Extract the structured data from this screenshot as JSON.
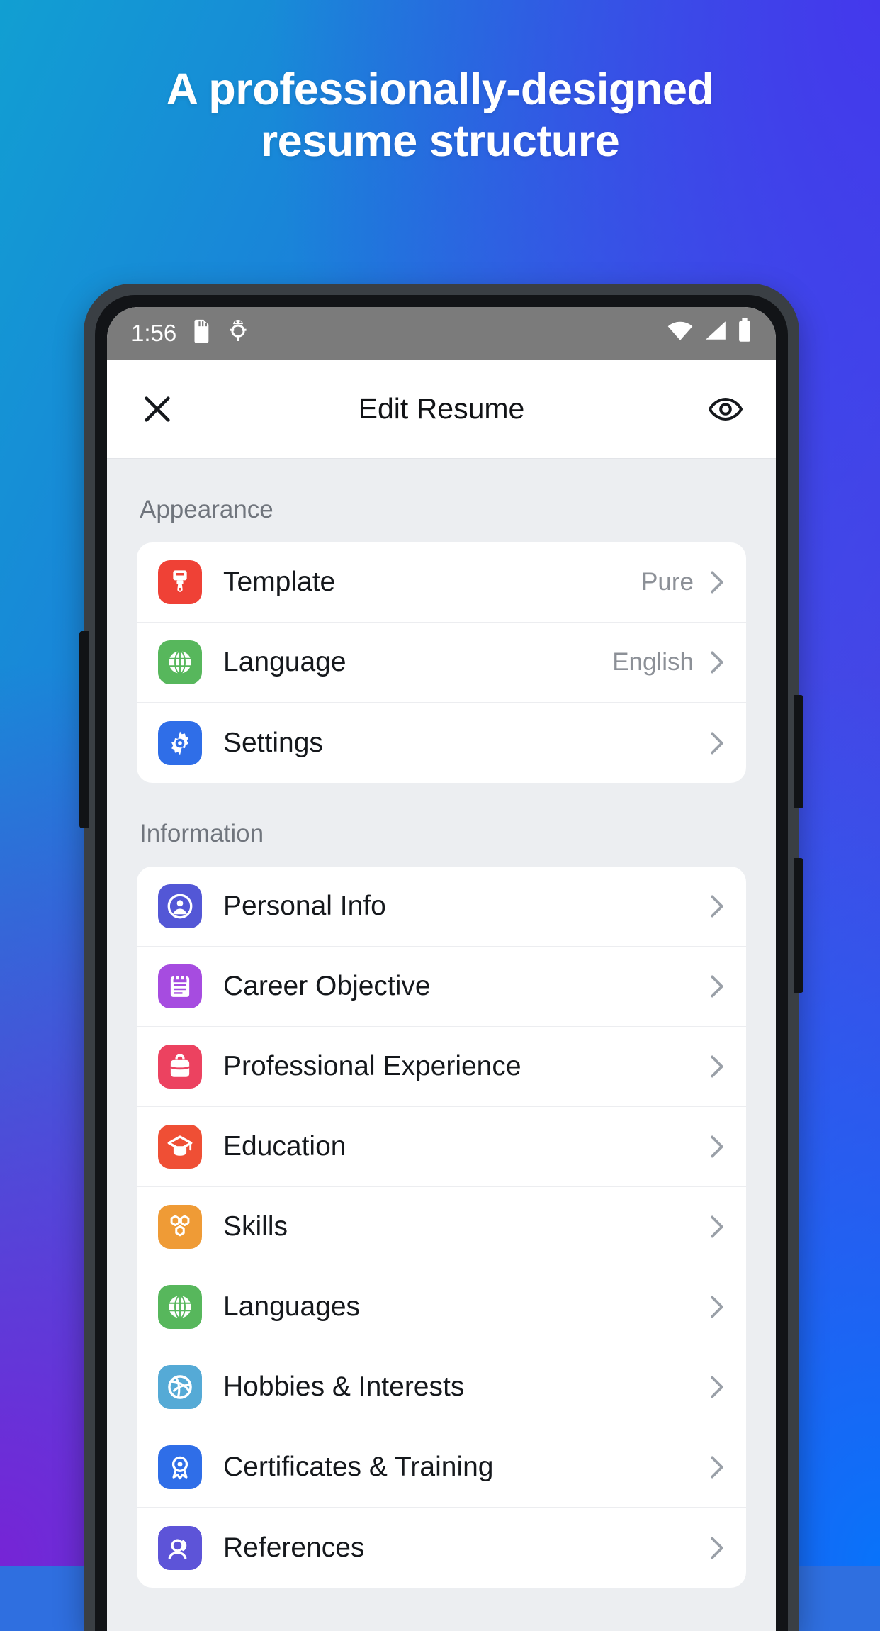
{
  "promo": {
    "headline_line1": "A professionally-designed",
    "headline_line2": "resume structure",
    "gradient": {
      "top_left": "#119fd2",
      "top_right": "#4438ec",
      "bottom_left": "#7624d6",
      "bottom_right": "#0873fa"
    }
  },
  "statusbar": {
    "time": "1:56",
    "left_icons": [
      "sd-card-icon",
      "usb-debug-icon"
    ],
    "right_icons": [
      "wifi-icon",
      "cellular-signal-icon",
      "battery-icon"
    ],
    "background": "#7b7b7b"
  },
  "appbar": {
    "close_label": "close-icon",
    "title": "Edit Resume",
    "preview_label": "eye-icon"
  },
  "sections": [
    {
      "title": "Appearance",
      "rows": [
        {
          "label": "Template",
          "value": "Pure",
          "icon": "brush-icon",
          "icon_color": "#ef4136"
        },
        {
          "label": "Language",
          "value": "English",
          "icon": "globe-icon",
          "icon_color": "#57b75c"
        },
        {
          "label": "Settings",
          "value": "",
          "icon": "gear-icon",
          "icon_color": "#2f6ee8"
        }
      ]
    },
    {
      "title": "Information",
      "rows": [
        {
          "label": "Personal Info",
          "value": "",
          "icon": "person-circle-icon",
          "icon_color": "#5357d6"
        },
        {
          "label": "Career Objective",
          "value": "",
          "icon": "notepad-icon",
          "icon_color": "#a64ce0"
        },
        {
          "label": "Professional Experience",
          "value": "",
          "icon": "briefcase-icon",
          "icon_color": "#ec4260"
        },
        {
          "label": "Education",
          "value": "",
          "icon": "graduation-cap-icon",
          "icon_color": "#ef4f35"
        },
        {
          "label": "Skills",
          "value": "",
          "icon": "honeycomb-icon",
          "icon_color": "#ef9b36"
        },
        {
          "label": "Languages",
          "value": "",
          "icon": "globe-icon",
          "icon_color": "#57b75c"
        },
        {
          "label": "Hobbies & Interests",
          "value": "",
          "icon": "basketball-icon",
          "icon_color": "#55aad6"
        },
        {
          "label": "Certificates & Training",
          "value": "",
          "icon": "award-ribbon-icon",
          "icon_color": "#2f6ee8"
        },
        {
          "label": "References",
          "value": "",
          "icon": "reference-icon",
          "icon_color": "#5d54d8"
        }
      ]
    }
  ]
}
